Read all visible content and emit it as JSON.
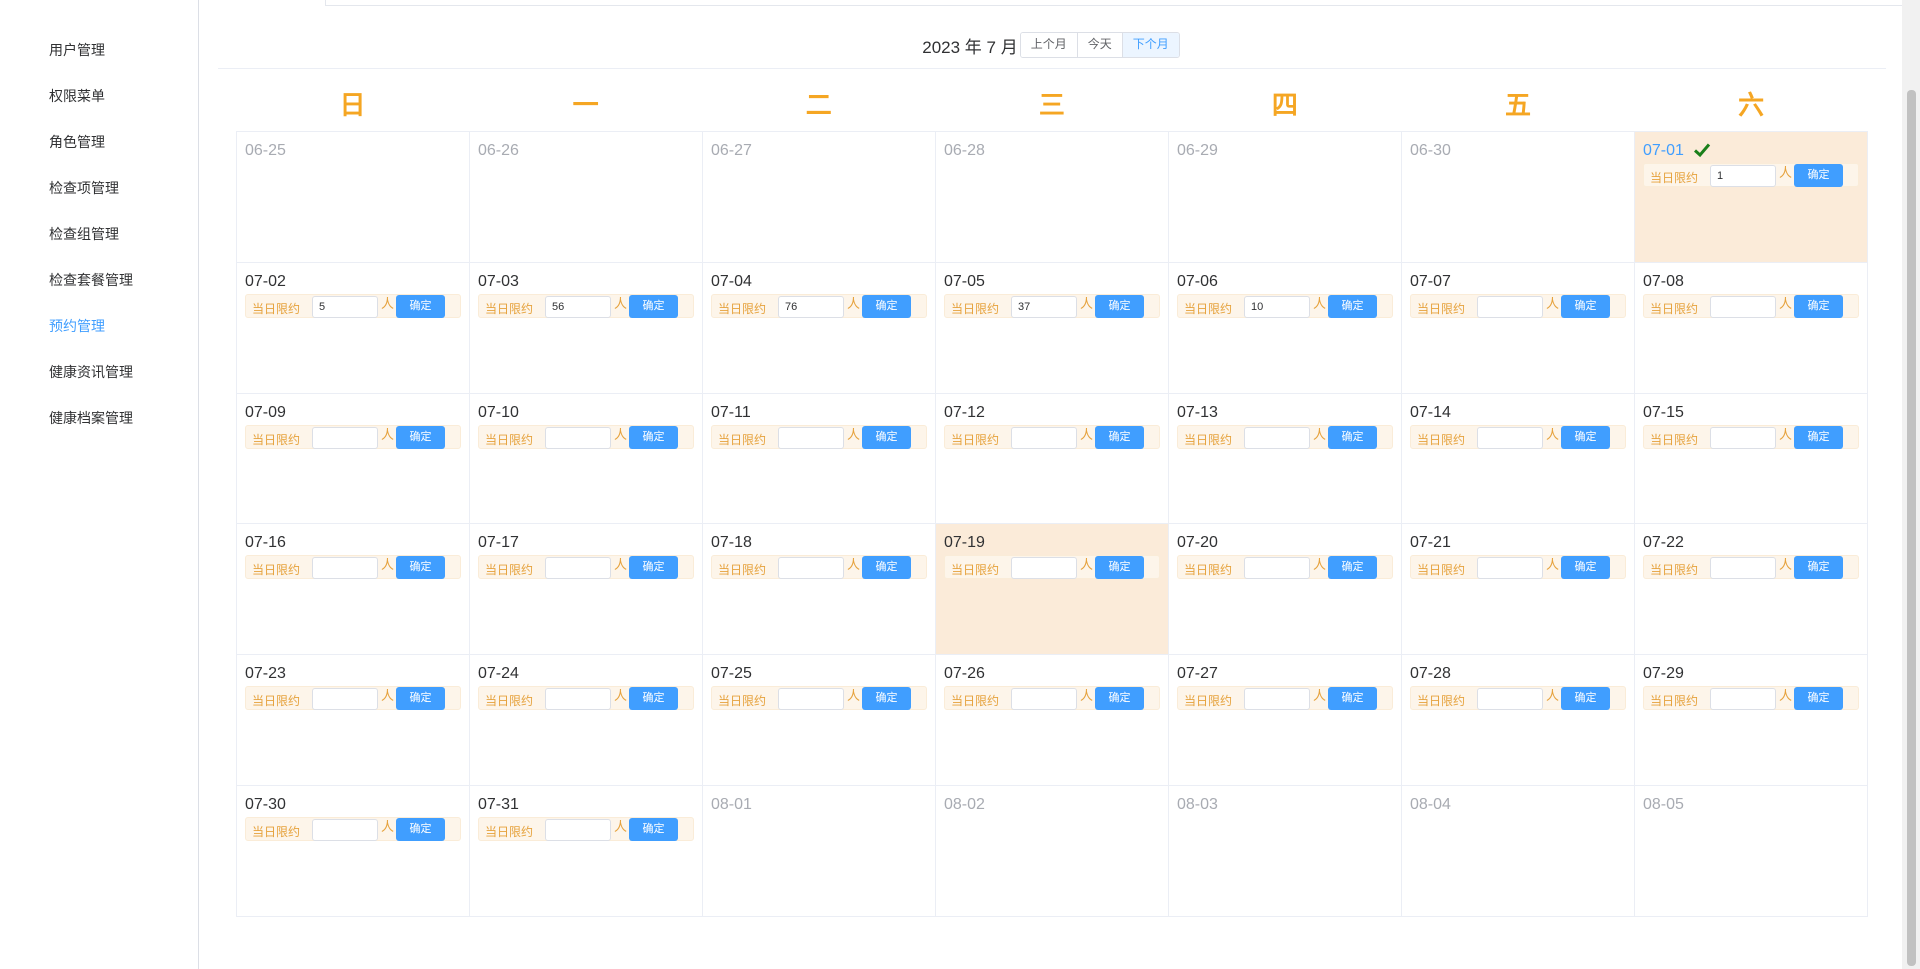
{
  "sidebar": {
    "items": [
      {
        "label": "用户管理",
        "active": false
      },
      {
        "label": "权限菜单",
        "active": false
      },
      {
        "label": "角色管理",
        "active": false
      },
      {
        "label": "检查项管理",
        "active": false
      },
      {
        "label": "检查组管理",
        "active": false
      },
      {
        "label": "检查套餐管理",
        "active": false
      },
      {
        "label": "预约管理",
        "active": true
      },
      {
        "label": "健康资讯管理",
        "active": false
      },
      {
        "label": "健康档案管理",
        "active": false
      }
    ]
  },
  "calendar": {
    "title": "2023 年 7 月",
    "prev_label": "上个月",
    "today_label": "今天",
    "next_label": "下个月",
    "weekdays": [
      "日",
      "一",
      "二",
      "三",
      "四",
      "五",
      "六"
    ],
    "limit_label": "当日限约",
    "unit": "人",
    "confirm_label": "确定",
    "days": [
      {
        "date": "06-25",
        "other": true
      },
      {
        "date": "06-26",
        "other": true
      },
      {
        "date": "06-27",
        "other": true
      },
      {
        "date": "06-28",
        "other": true
      },
      {
        "date": "06-29",
        "other": true
      },
      {
        "date": "06-30",
        "other": true
      },
      {
        "date": "07-01",
        "other": false,
        "limit": "1",
        "selected": true,
        "highlight": true
      },
      {
        "date": "07-02",
        "other": false,
        "limit": "5"
      },
      {
        "date": "07-03",
        "other": false,
        "limit": "56"
      },
      {
        "date": "07-04",
        "other": false,
        "limit": "76"
      },
      {
        "date": "07-05",
        "other": false,
        "limit": "37"
      },
      {
        "date": "07-06",
        "other": false,
        "limit": "10"
      },
      {
        "date": "07-07",
        "other": false,
        "limit": ""
      },
      {
        "date": "07-08",
        "other": false,
        "limit": ""
      },
      {
        "date": "07-09",
        "other": false,
        "limit": ""
      },
      {
        "date": "07-10",
        "other": false,
        "limit": ""
      },
      {
        "date": "07-11",
        "other": false,
        "limit": ""
      },
      {
        "date": "07-12",
        "other": false,
        "limit": ""
      },
      {
        "date": "07-13",
        "other": false,
        "limit": ""
      },
      {
        "date": "07-14",
        "other": false,
        "limit": ""
      },
      {
        "date": "07-15",
        "other": false,
        "limit": ""
      },
      {
        "date": "07-16",
        "other": false,
        "limit": ""
      },
      {
        "date": "07-17",
        "other": false,
        "limit": ""
      },
      {
        "date": "07-18",
        "other": false,
        "limit": ""
      },
      {
        "date": "07-19",
        "other": false,
        "limit": "",
        "highlight": true
      },
      {
        "date": "07-20",
        "other": false,
        "limit": ""
      },
      {
        "date": "07-21",
        "other": false,
        "limit": ""
      },
      {
        "date": "07-22",
        "other": false,
        "limit": ""
      },
      {
        "date": "07-23",
        "other": false,
        "limit": ""
      },
      {
        "date": "07-24",
        "other": false,
        "limit": ""
      },
      {
        "date": "07-25",
        "other": false,
        "limit": ""
      },
      {
        "date": "07-26",
        "other": false,
        "limit": ""
      },
      {
        "date": "07-27",
        "other": false,
        "limit": ""
      },
      {
        "date": "07-28",
        "other": false,
        "limit": ""
      },
      {
        "date": "07-29",
        "other": false,
        "limit": ""
      },
      {
        "date": "07-30",
        "other": false,
        "limit": ""
      },
      {
        "date": "07-31",
        "other": false,
        "limit": ""
      },
      {
        "date": "08-01",
        "other": true
      },
      {
        "date": "08-02",
        "other": true
      },
      {
        "date": "08-03",
        "other": true
      },
      {
        "date": "08-04",
        "other": true
      },
      {
        "date": "08-05",
        "other": true
      }
    ]
  },
  "colors": {
    "accent": "#409eff",
    "weekday": "#f5a623",
    "highlight_cell": "#fbebd9",
    "limit_text": "#e6a23c",
    "check": "#1a7f1a"
  }
}
